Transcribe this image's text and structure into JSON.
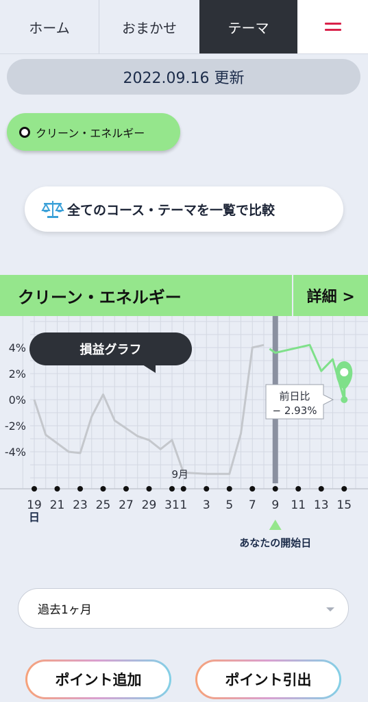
{
  "nav": {
    "tabs": [
      {
        "label": "ホーム"
      },
      {
        "label": "おまかせ"
      },
      {
        "label": "テーマ",
        "active": true
      }
    ],
    "menu_icon": "hamburger-icon"
  },
  "updated": "2022.09.16 更新",
  "theme_chip": {
    "label": "クリーン・エネルギー",
    "icon": "radio-selected-icon"
  },
  "compare_button": {
    "label": "全てのコース・テーマを一覧で比較",
    "icon": "scale-icon"
  },
  "section": {
    "title": "クリーン・エネルギー",
    "detail": "詳細 >"
  },
  "tooltip": {
    "label": "損益グラフ"
  },
  "chart_data": {
    "type": "line",
    "title": "損益グラフ",
    "y_tick_labels": [
      "4%",
      "2%",
      "0%",
      "-2%",
      "-4%"
    ],
    "y_ticks": [
      4,
      2,
      0,
      -2,
      -4
    ],
    "ylim": [
      -6.9,
      6.4
    ],
    "x_tick_labels": [
      "19",
      "21",
      "23",
      "25",
      "27",
      "29",
      "31",
      "1",
      "3",
      "5",
      "7",
      "9",
      "11",
      "13",
      "15"
    ],
    "x_unit_label": "日",
    "month_label": "9月",
    "x_days": [
      19,
      21,
      23,
      25,
      27,
      29,
      31,
      32,
      34,
      36,
      38,
      40,
      42,
      44,
      46
    ],
    "series": [
      {
        "x": [
          19,
          20,
          22,
          23,
          24,
          25,
          26,
          28,
          29,
          30,
          31,
          32,
          34,
          35,
          36,
          37,
          38,
          39
        ],
        "y": [
          0.0,
          -2.7,
          -4.0,
          -4.1,
          -1.3,
          0.4,
          -1.6,
          -2.8,
          -3.1,
          -3.8,
          -3.1,
          -5.6,
          -5.7,
          -5.7,
          -5.7,
          -2.6,
          4.0,
          4.2
        ],
        "color": "#c4c7cc"
      },
      {
        "x": [
          39.5,
          40,
          41,
          43,
          44,
          45,
          46
        ],
        "y": [
          3.9,
          3.6,
          3.8,
          4.2,
          2.2,
          3.1,
          0.0
        ],
        "color": "#7fe08a"
      }
    ],
    "start_day": 40,
    "start_label": "あなたの開始日",
    "change_callout": {
      "label": "前日比",
      "value": "− 2.93%"
    },
    "grid": true
  },
  "period_select": {
    "value": "過去1ヶ月"
  },
  "buttons": {
    "add_points": "ポイント追加",
    "withdraw_points": "ポイント引出"
  },
  "colors": {
    "accent_green": "#95e68c",
    "dark": "#2d3138",
    "line_gray": "#c4c7cc",
    "line_green": "#7fe08a",
    "menu_red": "#d9224a"
  }
}
